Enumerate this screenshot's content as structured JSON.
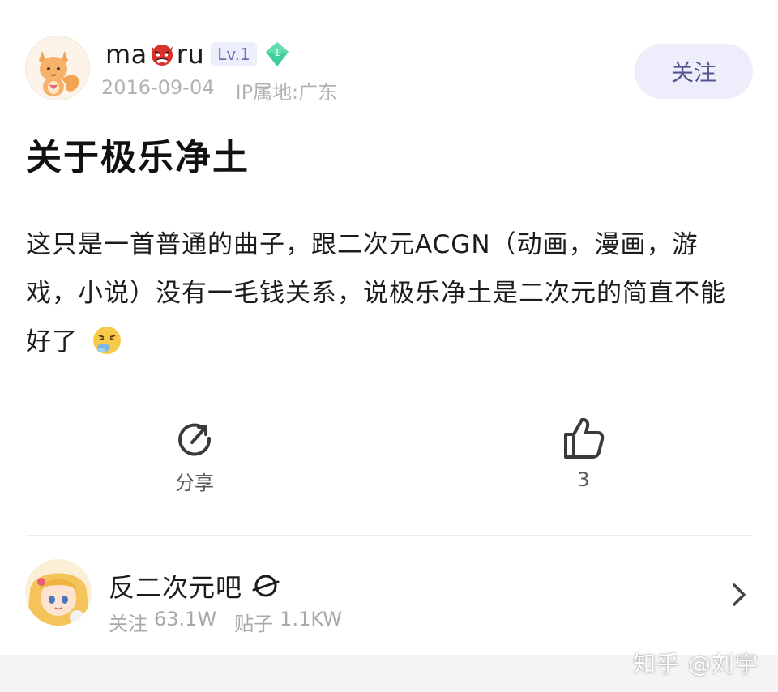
{
  "author": {
    "avatar_icon": "fox-avatar",
    "name_prefix": "ma",
    "name_emoji": "demon-mask-emoji",
    "name_suffix": "ru",
    "level": "Lv.1",
    "badge_number": "1",
    "date": "2016-09-04",
    "ip_location": "IP属地:广东"
  },
  "follow_label": "关注",
  "post": {
    "title": "关于极乐净土",
    "body": "这只是一首普通的曲子，跟二次元ACGN（动画，漫画，游戏，小说）没有一毛钱关系，说极乐净土是二次元的简直不能好了",
    "trailing_emoji": "disgusted-face-emoji"
  },
  "actions": {
    "share_label": "分享",
    "like_count": "3"
  },
  "forum": {
    "name": "反二次元吧",
    "followers_label": "关注",
    "followers_value": "63.1W",
    "posts_label": "贴子",
    "posts_value": "1.1KW"
  },
  "watermark": "知乎 @刘宇",
  "colors": {
    "accent_purple": "#54568f",
    "follow_bg": "#eeedfb",
    "gem_green": "#3ecf9a",
    "meta_gray": "#b3b3b3"
  }
}
